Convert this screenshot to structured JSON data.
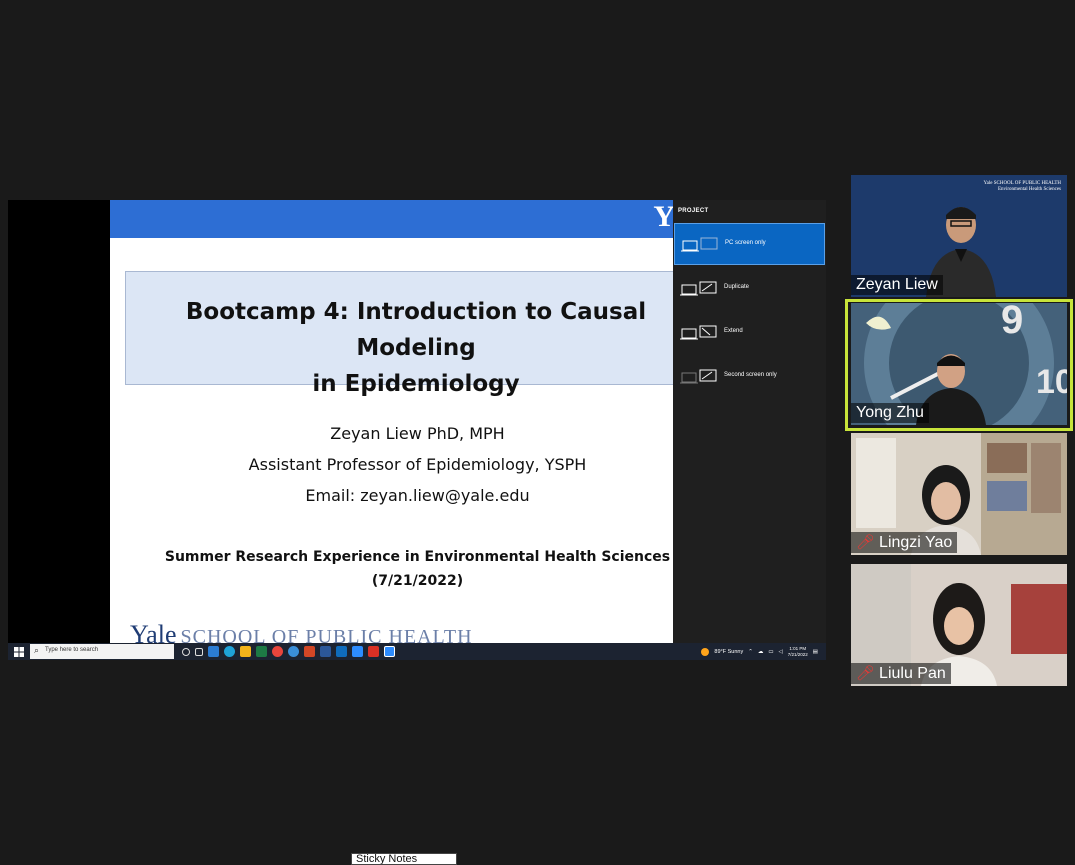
{
  "slide": {
    "title_line1": "Bootcamp 4: Introduction to Causal Modeling",
    "title_line2": "in Epidemiology",
    "author_name": "Zeyan Liew PhD, MPH",
    "author_role": "Assistant Professor of Epidemiology, YSPH",
    "author_email": "Email: zeyan.liew@yale.edu",
    "event_line1": "Summer Research Experience in Environmental Health Sciences",
    "event_line2": "(7/21/2022)",
    "logo_letter": "Y",
    "footer_yale": "Yale",
    "footer_school": "SCHOOL OF PUBLIC HEALTH"
  },
  "project_panel": {
    "title": "PROJECT",
    "options": [
      {
        "label": "PC screen only",
        "selected": true
      },
      {
        "label": "Duplicate",
        "selected": false
      },
      {
        "label": "Extend",
        "selected": false
      },
      {
        "label": "Second screen only",
        "selected": false
      }
    ]
  },
  "taskbar": {
    "search_placeholder": "Type here to search",
    "weather": "89°F Sunny",
    "time": "1:01 PM",
    "date": "7/21/2022"
  },
  "participants": [
    {
      "name": "Zeyan Liew",
      "muted": false,
      "active": false,
      "tile_logo": "Yale SCHOOL OF PUBLIC HEALTH",
      "tile_logo_sub": "Environmental Health Sciences"
    },
    {
      "name": "Yong Zhu",
      "muted": false,
      "active": true
    },
    {
      "name": "Lingzi Yao",
      "muted": true,
      "active": false
    },
    {
      "name": "Liulu Pan",
      "muted": true,
      "active": false
    }
  ],
  "sticky_notes_label": "Sticky Notes",
  "colors": {
    "background": "#1a1a1a",
    "slide_header": "#2d6ed4",
    "title_box": "#dce6f5",
    "project_selected": "#0a66c2",
    "active_speaker": "#c8e43a",
    "muted": "#e53935"
  }
}
